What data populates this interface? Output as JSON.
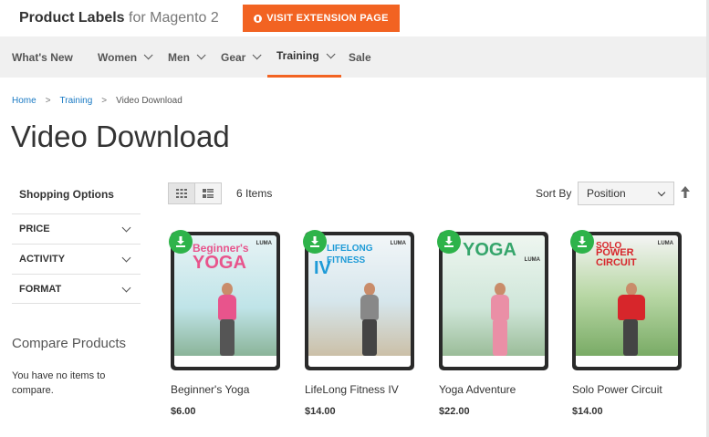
{
  "header": {
    "brand_strong": "Product Labels",
    "brand_light": "for Magento 2",
    "visit_button": "VISIT EXTENSION PAGE"
  },
  "nav": {
    "items": [
      {
        "label": "What's New",
        "dropdown": false
      },
      {
        "label": "Women",
        "dropdown": true
      },
      {
        "label": "Men",
        "dropdown": true
      },
      {
        "label": "Gear",
        "dropdown": true
      },
      {
        "label": "Training",
        "dropdown": true,
        "active": true
      },
      {
        "label": "Sale",
        "dropdown": false
      }
    ]
  },
  "breadcrumb": {
    "home": "Home",
    "training": "Training",
    "current": "Video Download"
  },
  "page_title": "Video Download",
  "sidebar": {
    "title": "Shopping Options",
    "filters": [
      "PRICE",
      "ACTIVITY",
      "FORMAT"
    ],
    "compare_title": "Compare Products",
    "compare_empty": "You have no items to compare."
  },
  "toolbar": {
    "items_count": "6 Items",
    "sort_label": "Sort By",
    "sort_value": "Position"
  },
  "products": [
    {
      "name": "Beginner's Yoga",
      "price": "$6.00",
      "cover_title": "Beginner's",
      "cover_big": "YOGA",
      "cover_bg": "#bfe4e8",
      "accent": "#e8548c"
    },
    {
      "name": "LifeLong Fitness IV",
      "price": "$14.00",
      "cover_title": "LIFELONG FITNESS",
      "cover_big": "IV",
      "cover_bg": "#d6e6ec",
      "accent": "#1e9bd7"
    },
    {
      "name": "Yoga Adventure",
      "price": "$22.00",
      "cover_title": "",
      "cover_big": "YOGA",
      "cover_bg": "#cfe6d9",
      "accent": "#35a56b"
    },
    {
      "name": "Solo Power Circuit",
      "price": "$14.00",
      "cover_title": "SOLO",
      "cover_big": "POWER CIRCUIT",
      "cover_bg": "#8ec07a",
      "accent": "#d7262b"
    }
  ],
  "colors": {
    "accent_orange": "#f26322",
    "download_badge": "#2eb34a",
    "link_blue": "#1979c3"
  },
  "icons": [
    "globe-icon",
    "chevron-down-icon",
    "grid-view-icon",
    "list-view-icon",
    "sort-arrow-up-icon",
    "download-icon"
  ]
}
